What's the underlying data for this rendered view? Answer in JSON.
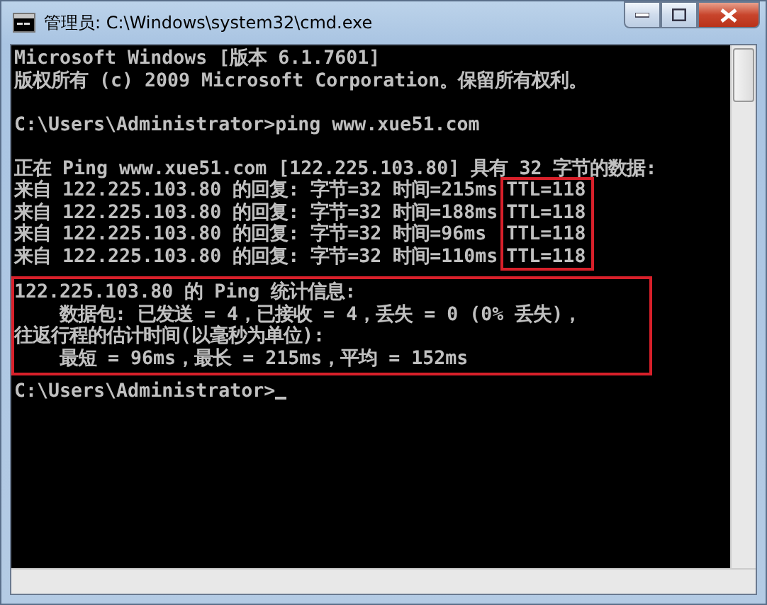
{
  "window": {
    "title": "管理员: C:\\Windows\\system32\\cmd.exe"
  },
  "console": {
    "blocks": [
      {
        "kind": "text",
        "lines": [
          "Microsoft Windows [版本 6.1.7601]",
          "版权所有 (c) 2009 Microsoft Corporation。保留所有权利。"
        ]
      },
      {
        "kind": "blank"
      },
      {
        "kind": "text",
        "lines": [
          "C:\\Users\\Administrator>ping www.xue51.com"
        ]
      },
      {
        "kind": "blank"
      },
      {
        "kind": "text",
        "lines": [
          "正在 Ping www.xue51.com [122.225.103.80] 具有 32 字节的数据:"
        ]
      },
      {
        "kind": "columns",
        "highlighted": true,
        "rows": [
          {
            "text": "来自 122.225.103.80 的回复: 字节=32 时间=215ms",
            "tail": "TTL=118"
          },
          {
            "text": "来自 122.225.103.80 的回复: 字节=32 时间=188ms",
            "tail": "TTL=118"
          },
          {
            "text": "来自 122.225.103.80 的回复: 字节=32 时间=96ms",
            "tail": "TTL=118"
          },
          {
            "text": "来自 122.225.103.80 的回复: 字节=32 时间=110ms",
            "tail": "TTL=118"
          }
        ]
      },
      {
        "kind": "text",
        "highlighted": true,
        "lines": [
          "122.225.103.80 的 Ping 统计信息:",
          "    数据包: 已发送 = 4，已接收 = 4，丢失 = 0 (0% 丢失)，",
          "往返行程的估计时间(以毫秒为单位):",
          "    最短 = 96ms，最长 = 215ms，平均 = 152ms"
        ]
      },
      {
        "kind": "prompt",
        "text": "C:\\Users\\Administrator>",
        "cursor": true
      }
    ]
  }
}
